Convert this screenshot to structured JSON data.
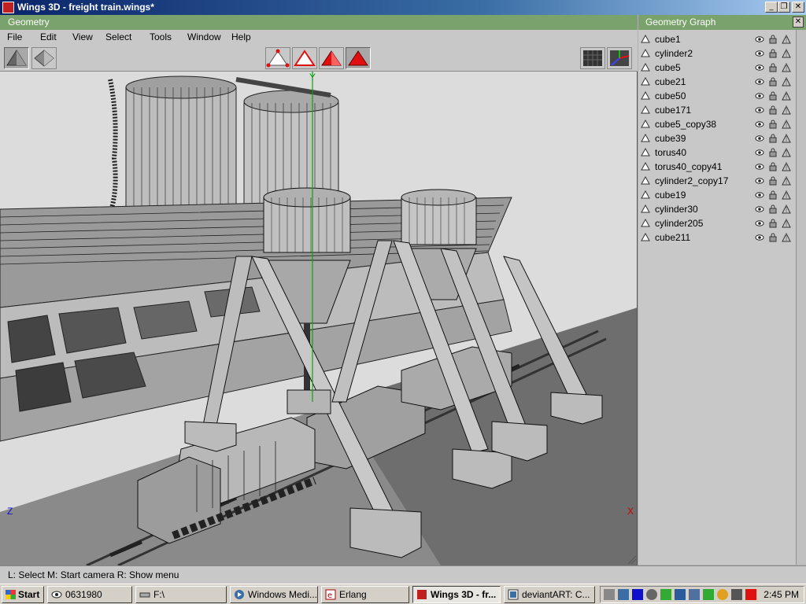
{
  "window": {
    "title": "Wings 3D - freight train.wings*"
  },
  "geometry": {
    "title": "Geometry",
    "menu": [
      "File",
      "Edit",
      "View",
      "Select",
      "Tools",
      "Window",
      "Help"
    ],
    "axis_labels": {
      "y": "Y",
      "z": "Z",
      "x": "X"
    }
  },
  "graph": {
    "title": "Geometry Graph",
    "objects": [
      "cube1",
      "cylinder2",
      "cube5",
      "cube21",
      "cube50",
      "cube171",
      "cube5_copy38",
      "cube39",
      "torus40",
      "torus40_copy41",
      "cylinder2_copy17",
      "cube19",
      "cylinder30",
      "cylinder205",
      "cube211"
    ]
  },
  "status": {
    "text": "L: Select   M: Start camera   R: Show menu"
  },
  "taskbar": {
    "start": "Start",
    "tasks": [
      "0631980",
      "F:\\",
      "Windows Medi...",
      "Erlang",
      "Wings 3D - fr...",
      "deviantART: C..."
    ],
    "clock": "2:45 PM"
  },
  "colors": {
    "header_green": "#7aa26c",
    "red_accent": "#e01010",
    "axis_y": "#10a010",
    "axis_x": "#cc0000",
    "axis_z": "#1010cc"
  }
}
